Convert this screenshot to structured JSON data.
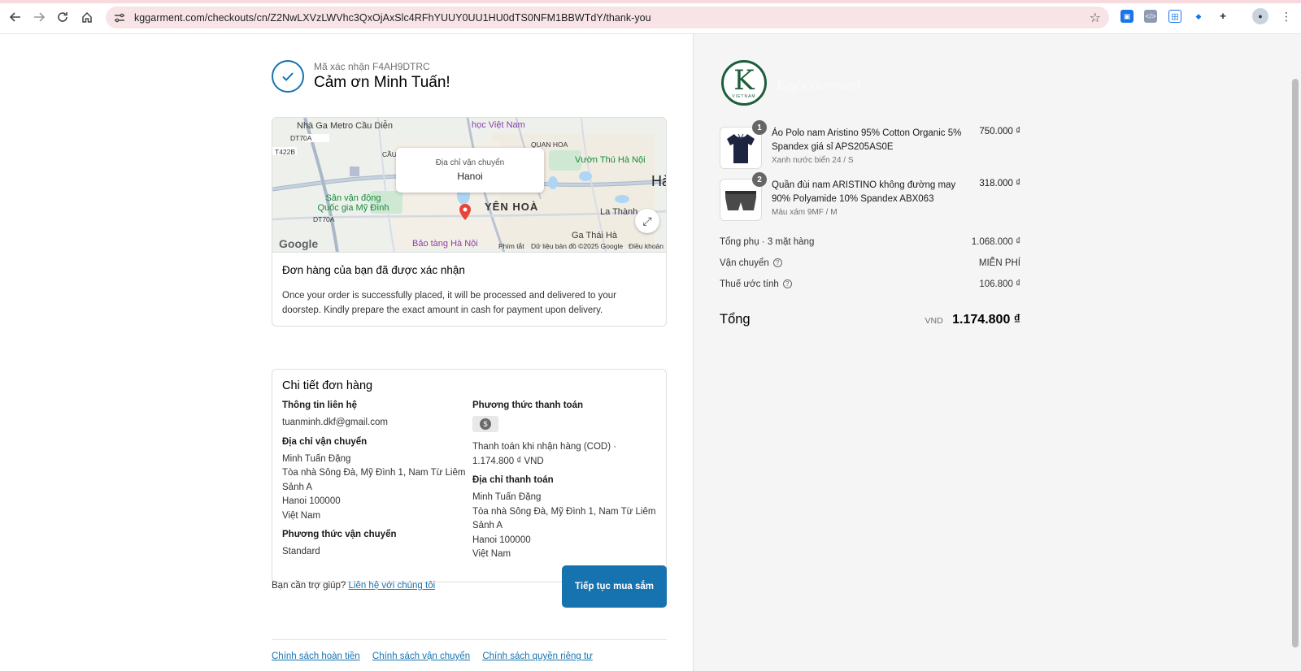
{
  "browser": {
    "url": "kggarment.com/checkouts/cn/Z2NwLXVzLWVhc3QxOjAxSlc4RFhYUUY0UU1HU0dTS0NFM1BBWTdY/thank-you",
    "back_icon": "arrow-left-icon",
    "forward_icon": "arrow-right-icon",
    "reload_icon": "reload-icon",
    "home_icon": "home-icon"
  },
  "confirmation": {
    "code": "Mã xác nhận F4AH9DTRC",
    "title": "Cảm ơn Minh Tuấn!"
  },
  "map": {
    "popup_label": "Địa chỉ vận chuyển",
    "popup_value": "Hanoi",
    "labels": {
      "metro": "Nhà Ga Metro Cầu Diễn",
      "school": "học Việt Nam",
      "quan_hoa": "QUAN HOA",
      "zoo": "Vườn Thú Hà Nội",
      "stadium": "Sân vận động Quốc gia Mỹ Đình",
      "yen_hoa": "YÊN HOÀ",
      "la_thanh": "La Thành",
      "ga_thai_ha": "Ga Thái Hà",
      "museum": "Bảo tàng Hà Nội",
      "ha": "Hà",
      "dt70a": "DT70A",
      "dt70a_2": "DT70A",
      "t422b": "T422B",
      "cau": "CẦU"
    },
    "footer": {
      "google": "Google",
      "shortcuts": "Phím tắt",
      "data": "Dữ liệu bản đồ ©2025 Google",
      "terms": "Điều khoản"
    }
  },
  "order_confirmed": {
    "title": "Đơn hàng của bạn đã được xác nhận",
    "body": "Once your order is successfully placed, it will be processed and delivered to your doorstep. Kindly prepare the exact amount in cash for payment upon delivery."
  },
  "details": {
    "title": "Chi tiết đơn hàng",
    "contact_label": "Thông tin liên hệ",
    "contact_email": "tuanminh.dkf@gmail.com",
    "shipping_address_label": "Địa chỉ vận chuyển",
    "shipping_address": [
      "Minh Tuấn Đặng",
      "Tòa nhà Sông Đà, Mỹ Đình 1, Nam Từ Liêm",
      "Sảnh A",
      "Hanoi 100000",
      "Việt Nam"
    ],
    "shipping_method_label": "Phương thức vận chuyển",
    "shipping_method": "Standard",
    "payment_method_label": "Phương thức thanh toán",
    "payment_method": "Thanh toán khi nhận hàng (COD) · 1.174.800 ₫ VND",
    "billing_address_label": "Địa chỉ thanh toán",
    "billing_address": [
      "Minh Tuấn Đặng",
      "Tòa nhà Sông Đà, Mỹ Đình 1, Nam Từ Liêm",
      "Sảnh A",
      "Hanoi 100000",
      "Việt Nam"
    ]
  },
  "help": {
    "text": "Bạn cần trợ giúp?",
    "link": "Liên hệ với chúng tôi"
  },
  "continue_button": "Tiếp tục mua sắm",
  "footer_links": [
    "Chính sách hoàn tiền",
    "Chính sách vận chuyển",
    "Chính sách quyền riêng tư"
  ],
  "summary": {
    "logo_text": "K",
    "logo_sub": "VIETNAM",
    "brand_name": "Key's Garment",
    "items": [
      {
        "qty": "1",
        "name": "Áo Polo nam Aristino 95% Cotton Organic 5% Spandex giá sỉ APS205AS0E",
        "variant": "Xanh nước biển 24 / S",
        "price": "750.000 ₫",
        "thumb_color": "#1d2440"
      },
      {
        "qty": "2",
        "name": "Quần đùi nam ARISTINO không đường may 90% Polyamide 10% Spandex ABX063",
        "variant": "Màu xám 9MF / M",
        "price": "318.000 ₫",
        "thumb_color": "#4a4a4a"
      }
    ],
    "subtotal_label": "Tổng phụ · 3 mặt hàng",
    "subtotal": "1.068.000 ₫",
    "shipping_label": "Vận chuyển",
    "shipping": "MIỄN PHÍ",
    "tax_label": "Thuế ước tính",
    "tax": "106.800 ₫",
    "total_label": "Tổng",
    "total_currency": "VND",
    "total": "1.174.800 ₫"
  }
}
